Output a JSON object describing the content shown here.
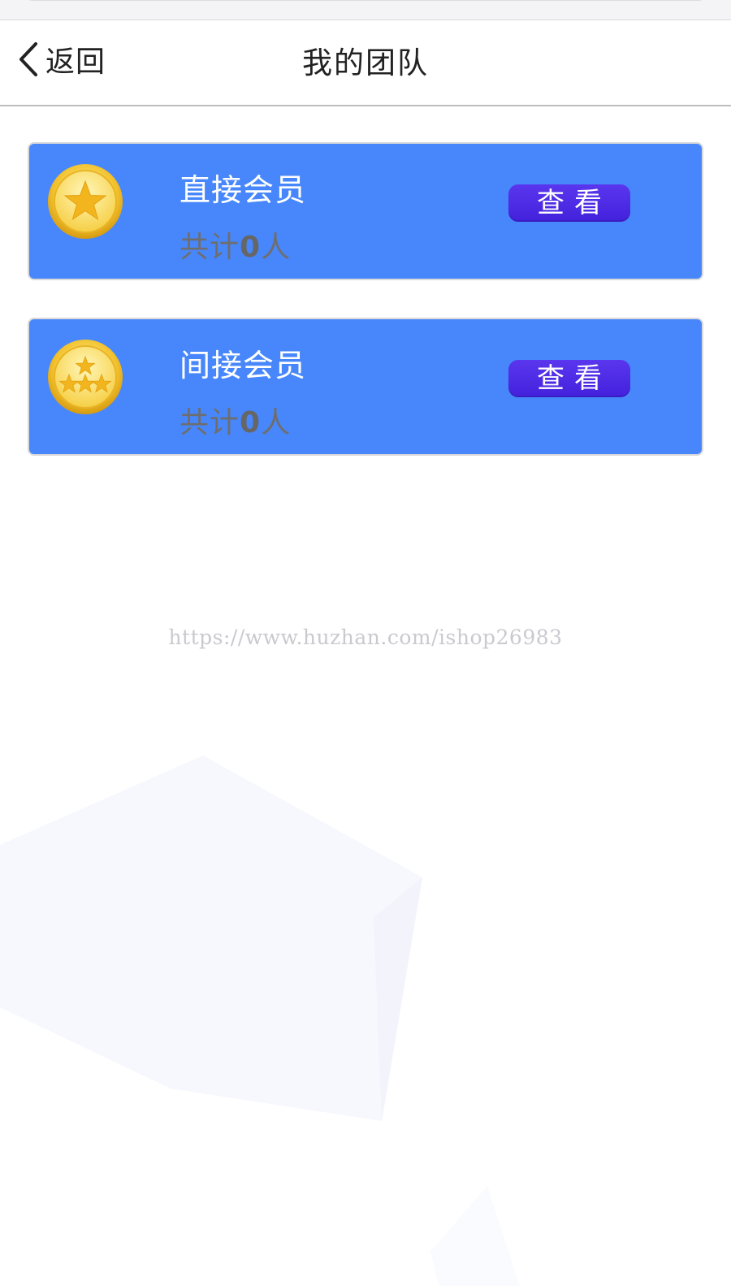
{
  "header": {
    "back_label": "返回",
    "title": "我的团队"
  },
  "cards": [
    {
      "title": "直接会员",
      "count_prefix": "共计",
      "count": "0",
      "count_suffix": "人",
      "button_label": "查看",
      "medal_icon": "gold-medal-one-star-icon"
    },
    {
      "title": "间接会员",
      "count_prefix": "共计",
      "count": "0",
      "count_suffix": "人",
      "button_label": "查看",
      "medal_icon": "gold-medal-four-stars-icon"
    }
  ],
  "watermark": {
    "text": "https://www.huzhan.com/ishop26983"
  },
  "colors": {
    "card_background": "#4787fb",
    "button_background": "#4b27e4",
    "header_text": "#222222",
    "count_text": "#6e6e6e"
  }
}
